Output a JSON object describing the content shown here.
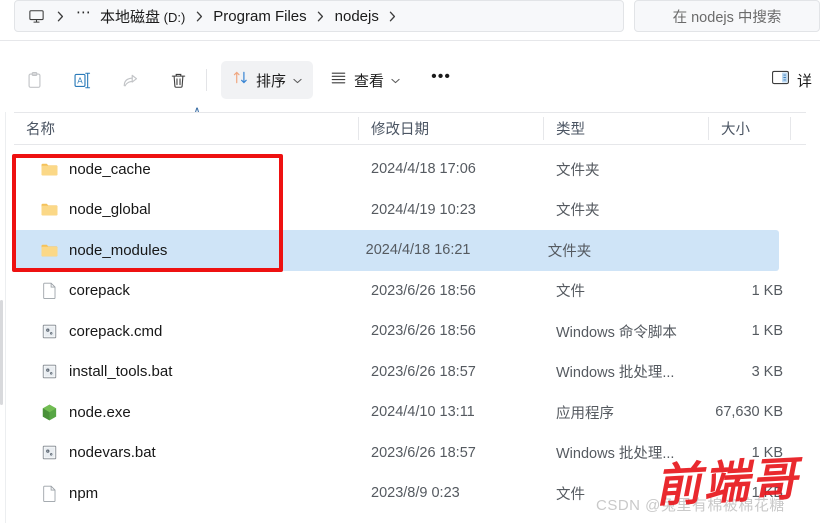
{
  "window": {
    "title": "nodejs"
  },
  "address_bar": {
    "pc_icon": "monitor-icon",
    "overflow": "⋯",
    "separator": "›",
    "crumbs": [
      {
        "label": "本地磁盘",
        "sub": " (D:)"
      },
      {
        "label": "Program Files",
        "sub": ""
      },
      {
        "label": "nodejs",
        "sub": ""
      }
    ]
  },
  "search": {
    "placeholder": "在 nodejs 中搜索",
    "value": ""
  },
  "toolbar": {
    "icons": [
      {
        "name": "paste-icon",
        "enabled": false
      },
      {
        "name": "rename-icon",
        "enabled": true
      },
      {
        "name": "share-icon",
        "enabled": false
      },
      {
        "name": "delete-icon",
        "enabled": true
      }
    ],
    "sort_label": "排序",
    "view_label": "查看",
    "more_label": "•••",
    "details_label": "详",
    "caret": "⌄"
  },
  "columns": {
    "name": "名称",
    "date": "修改日期",
    "type": "类型",
    "size": "大小",
    "sort_indicator": "∧"
  },
  "files": [
    {
      "name": "node_cache",
      "date": "2024/4/18 17:06",
      "type": "文件夹",
      "size": "",
      "icon": "folder-icon",
      "selected": false
    },
    {
      "name": "node_global",
      "date": "2024/4/19 10:23",
      "type": "文件夹",
      "size": "",
      "icon": "folder-icon",
      "selected": false
    },
    {
      "name": "node_modules",
      "date": "2024/4/18 16:21",
      "type": "文件夹",
      "size": "",
      "icon": "folder-icon",
      "selected": true
    },
    {
      "name": "corepack",
      "date": "2023/6/26 18:56",
      "type": "文件",
      "size": "1 KB",
      "icon": "file-blank-icon",
      "selected": false
    },
    {
      "name": "corepack.cmd",
      "date": "2023/6/26 18:56",
      "type": "Windows 命令脚本",
      "size": "1 KB",
      "icon": "script-icon",
      "selected": false
    },
    {
      "name": "install_tools.bat",
      "date": "2023/6/26 18:57",
      "type": "Windows 批处理...",
      "size": "3 KB",
      "icon": "script-icon",
      "selected": false
    },
    {
      "name": "node.exe",
      "date": "2024/4/10 13:11",
      "type": "应用程序",
      "size": "67,630 KB",
      "icon": "nodejs-hex-icon",
      "selected": false
    },
    {
      "name": "nodevars.bat",
      "date": "2023/6/26 18:57",
      "type": "Windows 批处理...",
      "size": "1 KB",
      "icon": "script-icon",
      "selected": false
    },
    {
      "name": "npm",
      "date": "2023/8/9 0:23",
      "type": "文件",
      "size": "1 KB",
      "icon": "file-blank-icon",
      "selected": false
    }
  ],
  "annotation": {
    "shape": "red-rectangle",
    "color": "#ee1111"
  },
  "watermarks": {
    "csdn": "CSDN @兔里有棉被棉花糖",
    "red": "前端哥"
  },
  "colors": {
    "selection": "#cfe4f7",
    "folder": "#f6c96b",
    "node_green": "#57a645",
    "accent": "#3a6ea5"
  }
}
